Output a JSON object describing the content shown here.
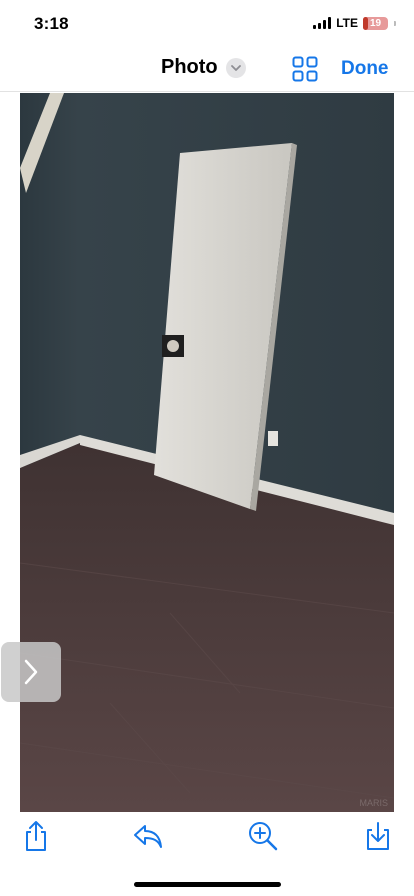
{
  "status_bar": {
    "time": "3:18",
    "network": "LTE",
    "battery_level": "19"
  },
  "nav": {
    "title": "Photo",
    "done_label": "Done",
    "accent_color": "#1677e8"
  },
  "photo": {
    "watermark": "MARIS"
  },
  "toolbar": {
    "icons": [
      "share-icon",
      "reply-icon",
      "zoom-in-icon",
      "download-icon"
    ]
  },
  "colors": {
    "wall": "#36434a",
    "floor": "#4e3d3d",
    "door": "#d8d6d1",
    "battery": "#c0392b"
  }
}
